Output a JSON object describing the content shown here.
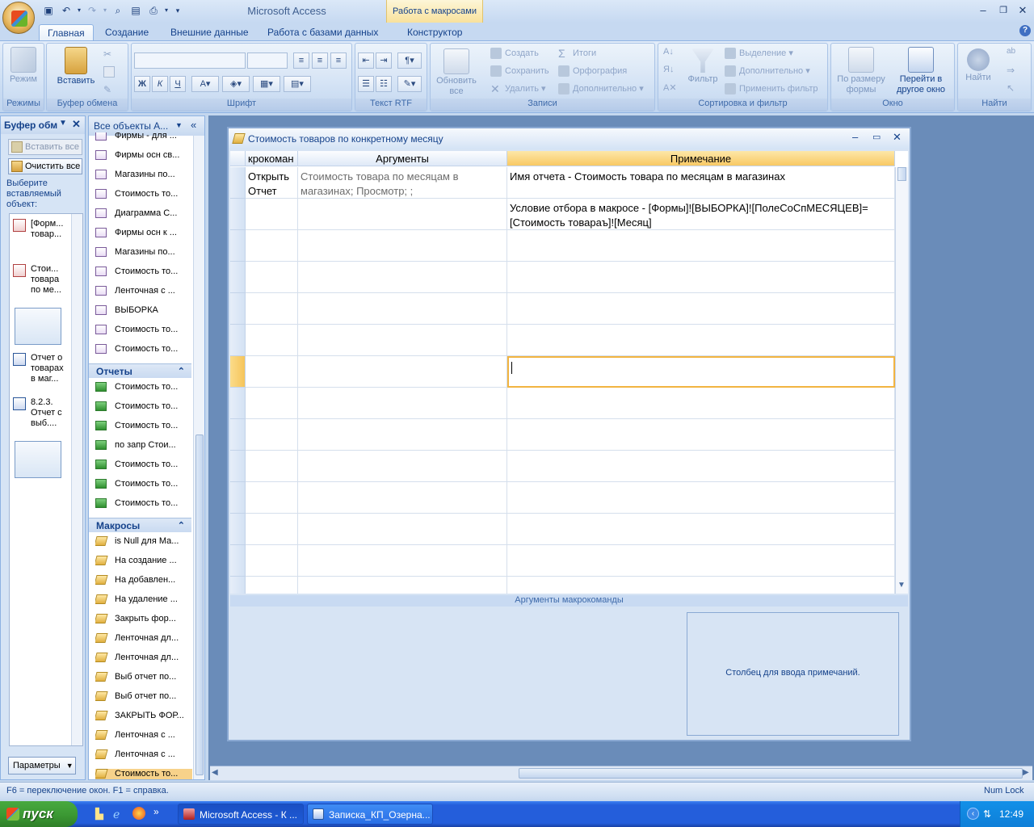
{
  "app": {
    "title": "Microsoft Access",
    "context_tab_title": "Работа с макросами"
  },
  "window_controls": {
    "minimize": "–",
    "restore": "❐",
    "close": "✕"
  },
  "ribbon_tabs": [
    {
      "label": "Главная",
      "active": true
    },
    {
      "label": "Создание"
    },
    {
      "label": "Внешние данные"
    },
    {
      "label": "Работа с базами данных"
    },
    {
      "label": "Конструктор"
    }
  ],
  "ribbon": {
    "groups": {
      "modes": "Режимы",
      "clipboard": "Буфер обмена",
      "font": "Шрифт",
      "rtf": "Текст RTF",
      "records": "Записи",
      "sort_filter": "Сортировка и фильтр",
      "window": "Окно",
      "find": "Найти"
    },
    "buttons": {
      "mode": "Режим",
      "paste": "Вставить",
      "refresh_all_line1": "Обновить",
      "refresh_all_line2": "все",
      "create": "Создать",
      "save": "Сохранить",
      "delete": "Удалить",
      "totals": "Итоги",
      "spelling": "Орфография",
      "more": "Дополнительно",
      "filter": "Фильтр",
      "selection": "Выделение",
      "advanced": "Дополнительно",
      "apply_filter": "Применить фильтр",
      "fit_form_line1": "По размеру",
      "fit_form_line2": "формы",
      "switch_window_line1": "Перейти в",
      "switch_window_line2": "другое окно",
      "find": "Найти"
    },
    "font_buttons": [
      "Ж",
      "К",
      "Ч"
    ]
  },
  "clipboard_pane": {
    "title": "Буфер обм",
    "paste_all": "Вставить все",
    "clear_all": "Очистить все",
    "hint": "Выберите вставляемый объект:",
    "items": [
      {
        "lines": [
          "[Форм...",
          "товар..."
        ]
      },
      {
        "lines": [
          "Стои...",
          "товара",
          "по ме..."
        ]
      },
      {
        "lines": [
          "Отчет о",
          "товарах",
          "в маг..."
        ]
      },
      {
        "lines": [
          "8.2.3.",
          "Отчет с",
          "выб...."
        ]
      }
    ],
    "params": "Параметры"
  },
  "nav_pane": {
    "title": "Все объекты А...",
    "forms": [
      "Фирмы - для ...",
      "Фирмы осн св...",
      "Магазины по...",
      "Стоимость то...",
      "Диаграмма С...",
      "Фирмы осн к ...",
      "Магазины по...",
      "Стоимость то...",
      "Ленточная с ...",
      "ВЫБОРКА",
      "Стоимость то...",
      "Стоимость то..."
    ],
    "reports_title": "Отчеты",
    "reports": [
      "Стоимость то...",
      "Стоимость то...",
      "Стоимость то...",
      "по запр Стои...",
      "Стоимость то...",
      "Стоимость то...",
      "Стоимость то..."
    ],
    "macros_title": "Макросы",
    "macros": [
      "is Null для Ма...",
      "На создание ...",
      "На добавлен...",
      "На удаление ...",
      "Закрыть фор...",
      "Ленточная дл...",
      "Ленточная дл...",
      "Выб отчет по...",
      "Выб отчет по...",
      "ЗАКРЫТЬ ФОР...",
      "Ленточная с ...",
      "Ленточная с ...",
      "Стоимость то..."
    ]
  },
  "macro_window": {
    "title": "Стоимость товаров по конкретному месяцу",
    "columns": [
      "крокоман",
      "Аргументы",
      "Примечание"
    ],
    "rows": [
      {
        "action": "Открыть Отчет",
        "args": "Стоимость товара по месяцам в магазинах; Просмотр; ;",
        "note": "Имя отчета - Стоимость товара по месяцам в магазинах"
      },
      {
        "action": "",
        "args": "",
        "note": "Условие отбора в макросе - [Формы]![ВЫБОРКА]![ПолеСоСпМЕСЯЦЕВ]=[Стоимость товараъ]![Месяц]"
      }
    ],
    "args_panel_label": "Аргументы макрокоманды",
    "hint": "Столбец для ввода примечаний."
  },
  "statusbar": {
    "left": "F6 = переключение окон.  F1 = справка.",
    "right": "Num Lock"
  },
  "taskbar": {
    "start": "пуск",
    "tasks": [
      {
        "label": "Microsoft Access - К ...",
        "active": true
      },
      {
        "label": "Записка_КП_Озерна..."
      }
    ],
    "clock": "12:49"
  },
  "colors": {
    "accent": "#15428b",
    "ribbon_bg": "#c6d9f1",
    "active_row": "#f8c964"
  }
}
